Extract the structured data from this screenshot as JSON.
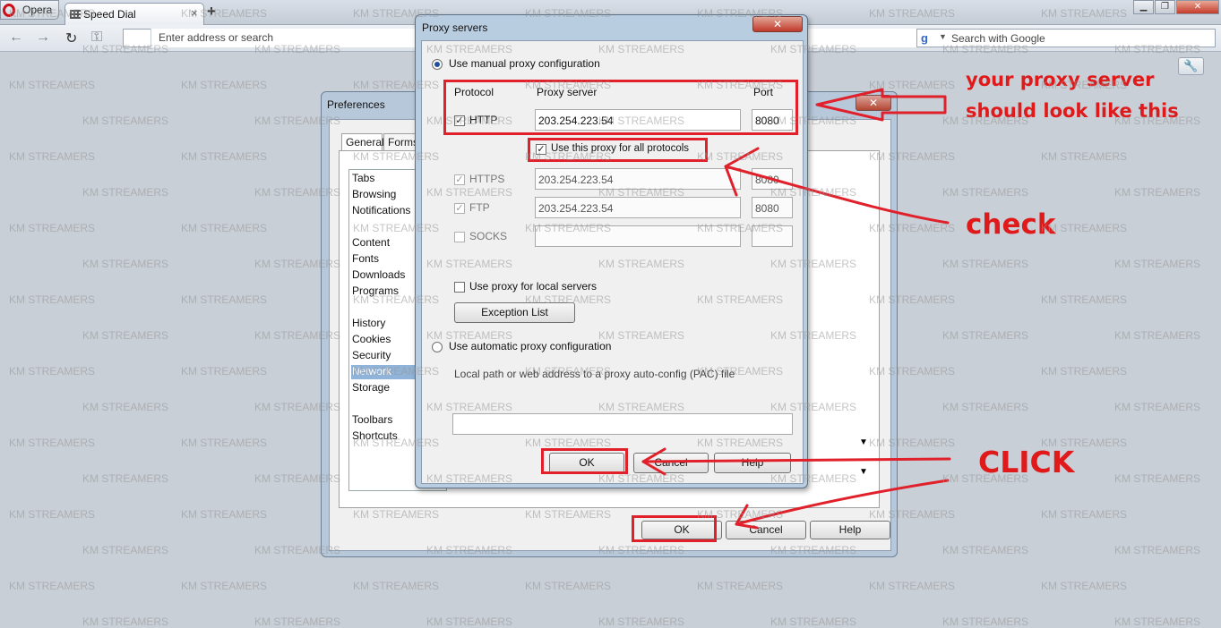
{
  "browser": {
    "menu_label": "Opera",
    "tab_label": "Speed Dial",
    "address_placeholder": "Enter address or search",
    "search_placeholder": "Search with Google",
    "search_engine_icon": "g",
    "wrench_icon": "🔧"
  },
  "preferences": {
    "title": "Preferences",
    "close_icon": "✕",
    "tabs": [
      "General",
      "Forms"
    ],
    "sections": [
      "Tabs",
      "Browsing",
      "Notifications",
      "Content",
      "Fonts",
      "Downloads",
      "Programs",
      "History",
      "Cookies",
      "Security",
      "Network",
      "Storage",
      "Toolbars",
      "Shortcuts"
    ],
    "selected_section": "Network",
    "ok_label": "OK",
    "cancel_label": "Cancel",
    "help_label": "Help"
  },
  "proxy": {
    "title": "Proxy servers",
    "close_icon": "✕",
    "manual_label": "Use manual proxy configuration",
    "col_protocol": "Protocol",
    "col_server": "Proxy server",
    "col_port": "Port",
    "rows": [
      {
        "protocol": "HTTP",
        "server": "203.254.223.54",
        "port": "8080",
        "checked": true
      },
      {
        "protocol": "HTTPS",
        "server": "203.254.223.54",
        "port": "8080",
        "checked": true
      },
      {
        "protocol": "FTP",
        "server": "203.254.223.54",
        "port": "8080",
        "checked": true
      },
      {
        "protocol": "SOCKS",
        "server": "",
        "port": "",
        "checked": false
      }
    ],
    "use_all_label": "Use this proxy for all protocols",
    "local_label": "Use proxy for local servers",
    "exception_label": "Exception List",
    "auto_label": "Use automatic proxy configuration",
    "pac_label": "Local path or web address to a proxy auto-config (PAC) file",
    "ok_label": "OK",
    "cancel_label": "Cancel",
    "help_label": "Help"
  },
  "annotations": {
    "proxy_note_line1": "your proxy server",
    "proxy_note_line2": "should look like this",
    "check_note": "check",
    "click_note": "CLICK",
    "color": "#e0202a"
  },
  "watermark": "KM STREAMERS"
}
